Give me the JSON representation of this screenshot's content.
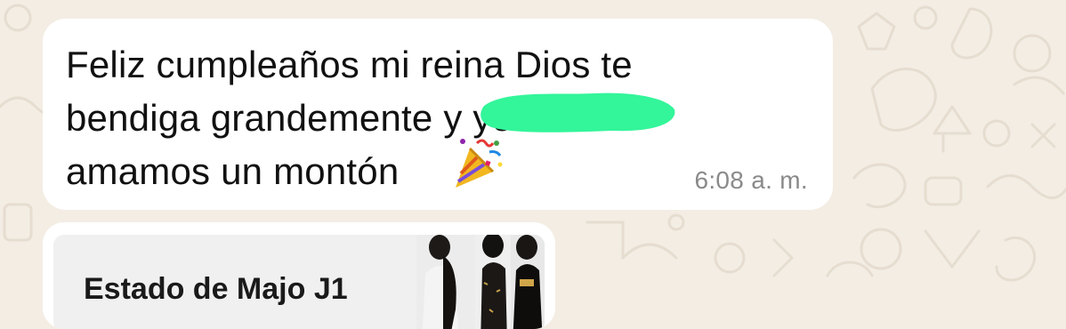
{
  "message": {
    "text": "Feliz cumpleaños mi reina Dios te\nbendiga grandemente                   y yo te\namamos un montón",
    "emoji": "party-popper-icon",
    "time": "6:08 a. m.",
    "redaction_color": "#33f59a"
  },
  "status_reply": {
    "title": "Estado de Majo J1"
  },
  "colors": {
    "background": "#f3ede4",
    "bubble": "#ffffff",
    "time_text": "#8a8a8a"
  }
}
